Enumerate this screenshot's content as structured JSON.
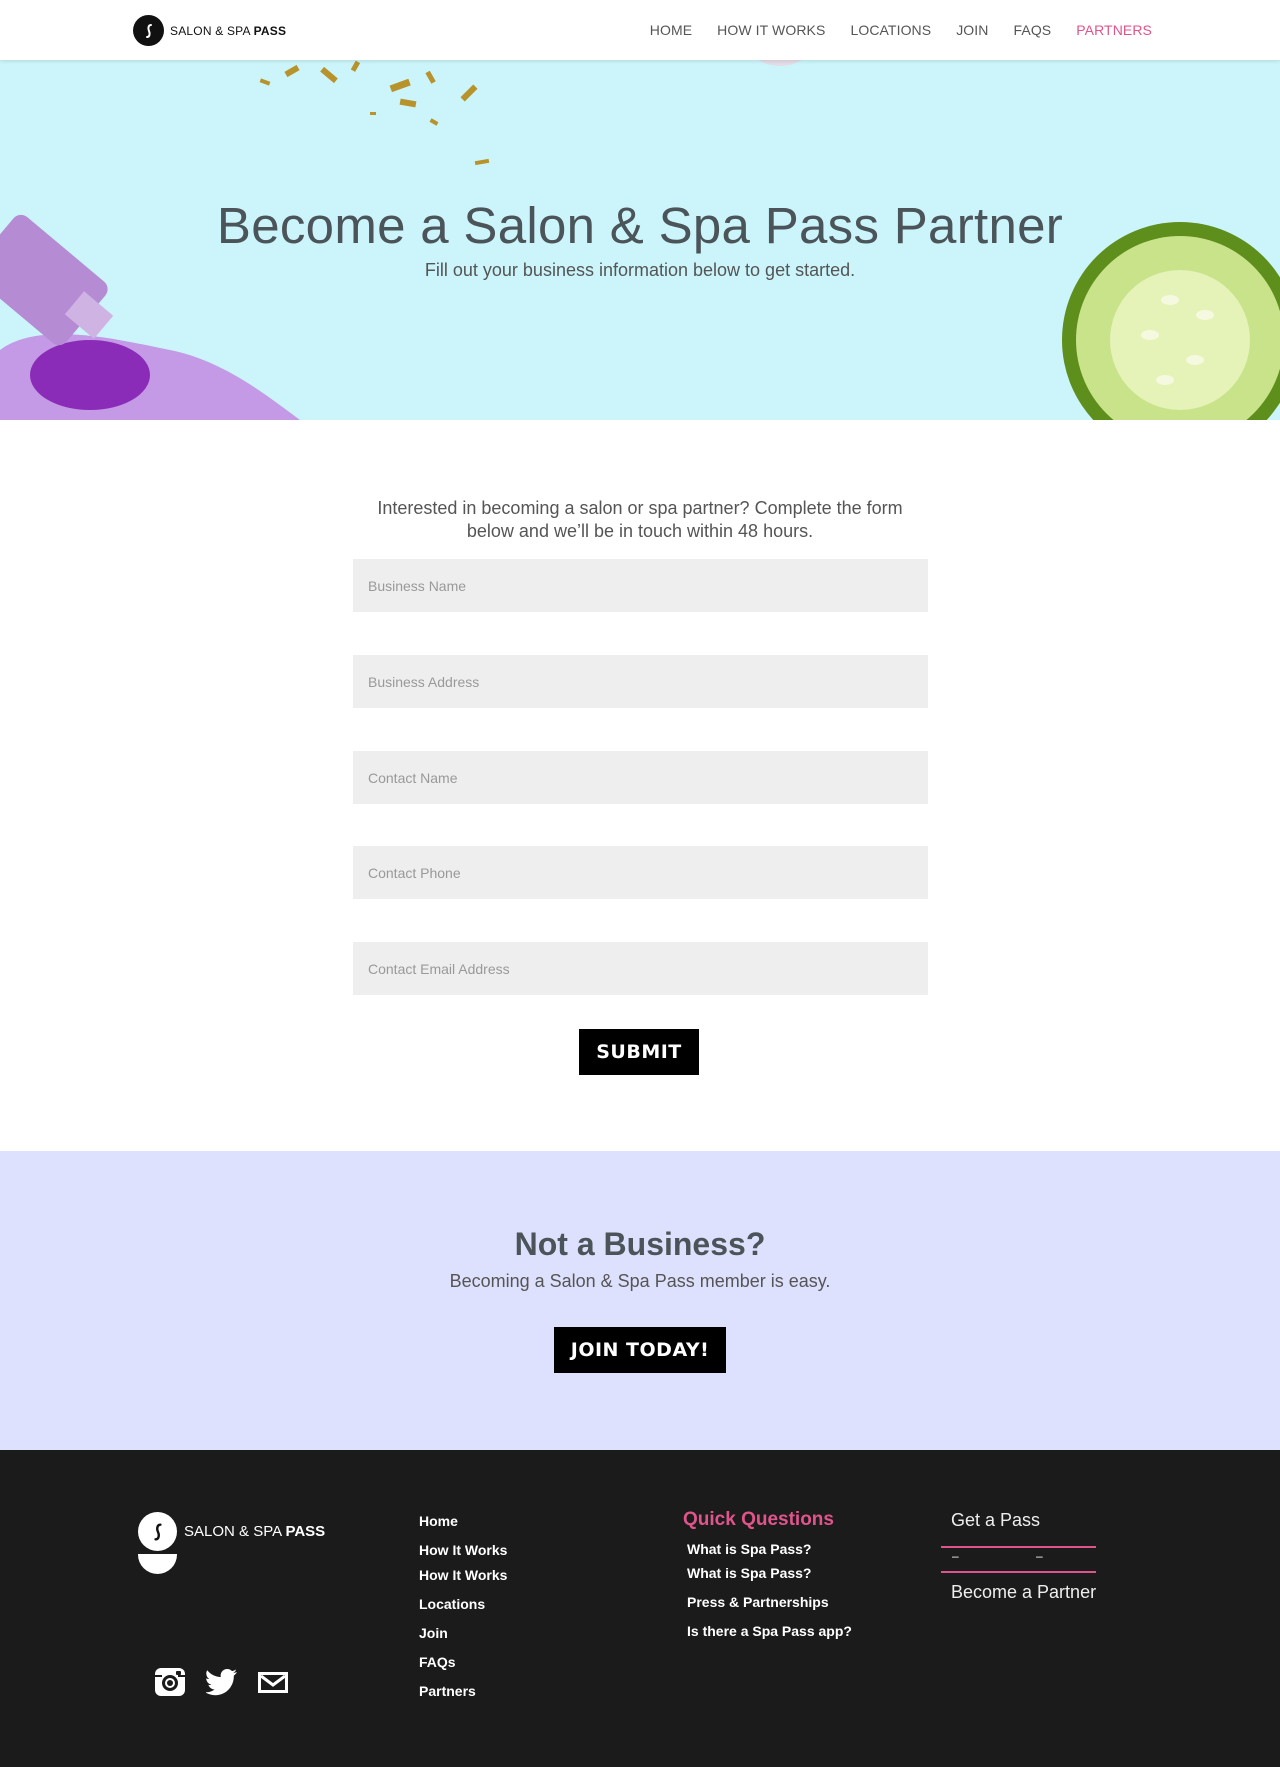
{
  "header": {
    "logo_text_light": "SALON & SPA",
    "logo_text_bold": "PASS",
    "nav": [
      {
        "label": "HOME"
      },
      {
        "label": "HOW IT WORKS"
      },
      {
        "label": "LOCATIONS"
      },
      {
        "label": "JOIN"
      },
      {
        "label": "FAQS"
      },
      {
        "label": "PARTNERS"
      }
    ]
  },
  "hero": {
    "title": "Become a Salon & Spa Pass Partner",
    "subtitle": "Fill out your business information below to get started."
  },
  "form": {
    "intro": "Interested in becoming a salon or spa partner? Complete the form below and we’ll be in touch within 48 hours.",
    "fields": [
      {
        "placeholder": "Business Name"
      },
      {
        "placeholder": "Business Address"
      },
      {
        "placeholder": "Contact Name"
      },
      {
        "placeholder": "Contact Phone"
      },
      {
        "placeholder": "Contact Email Address"
      }
    ],
    "submit_label": "SUBMIT"
  },
  "cta": {
    "title": "Not a Business?",
    "subtitle": "Becoming a Salon & Spa Pass member is easy.",
    "button_label": "JOIN TODAY!"
  },
  "footer": {
    "logo_text_light": "SALON & SPA",
    "logo_text_bold": "PASS",
    "links": [
      "Home",
      "How It Works",
      "How It Works",
      "Locations",
      "Join",
      "FAQs",
      "Partners"
    ],
    "quick_title": "Quick Questions",
    "quick_links": [
      "What is Spa Pass?",
      "What is Spa Pass?",
      "Press & Partnerships",
      "Is there a Spa Pass app?"
    ],
    "get_pass": "Get a Pass",
    "dash_left": "–",
    "dash_right": "–",
    "become_partner": "Become a Partner",
    "social_icons": [
      "instagram-icon",
      "twitter-icon",
      "mail-icon"
    ]
  },
  "colors": {
    "accent": "#e0548c",
    "hero_bg": "#cbf5fb",
    "cta_bg": "#dee1fd",
    "footer_bg": "#1b1b1b",
    "field_bg": "#eeeeee"
  }
}
